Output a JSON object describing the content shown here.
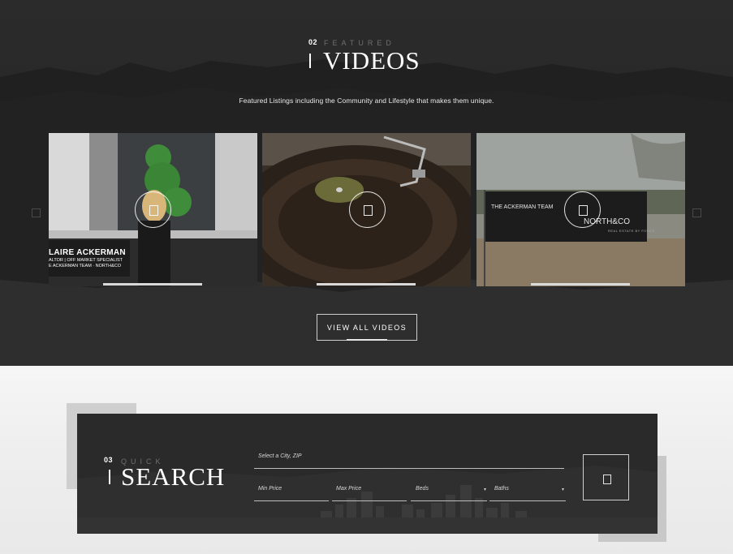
{
  "videos": {
    "number": "02",
    "kicker": "FEATURED",
    "title": "VIDEOS",
    "subtitle": "Featured Listings including the Community and Lifestyle that makes them unique.",
    "cards": [
      {
        "lower_third": [
          "LAIRE ACKERMAN",
          "ALTOR | OFF MARKET SPECIALIST",
          "E ACKERMAN TEAM · NORTH&CO"
        ]
      },
      {
        "lower_third": []
      },
      {
        "banner": [
          "THE ACKERMAN TEAM",
          "NORTH&CO",
          "REAL ESTATE BY FORCE"
        ]
      }
    ],
    "cta_label": "VIEW ALL VIDEOS",
    "icons": [
      "play-icon",
      "arrow-left-icon",
      "arrow-right-icon"
    ]
  },
  "search": {
    "number": "03",
    "kicker": "QUICK",
    "title": "SEARCH",
    "location_placeholder": "Select a City, ZIP",
    "min_price_placeholder": "Min Price",
    "max_price_placeholder": "Max Price",
    "beds_label": "Beds",
    "baths_label": "Baths",
    "caret": "▾",
    "icons": [
      "search-icon",
      "chevron-down-icon"
    ]
  },
  "colors": {
    "dark_bg": "#2b2b2b",
    "panel_bg": "#2a2a2a",
    "light_bg": "#f2f2f2",
    "accent_text": "#ffffff",
    "muted_text": "#6e6e6e"
  }
}
